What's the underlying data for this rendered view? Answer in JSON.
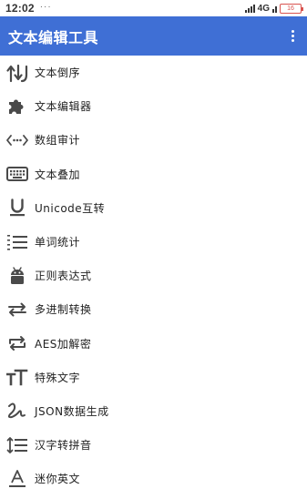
{
  "status_bar": {
    "time": "12:02",
    "dots": "···",
    "network": "4G",
    "battery": "16"
  },
  "app_bar": {
    "title": "文本编辑工具",
    "overflow_icon": "more-vertical-icon"
  },
  "colors": {
    "primary": "#3f6fd5",
    "icon": "#4a4a4a",
    "text": "#222222",
    "battery": "#d9534f"
  },
  "menu": {
    "items": [
      {
        "label": "文本倒序",
        "icon": "swap-vertical-icon"
      },
      {
        "label": "文本编辑器",
        "icon": "puzzle-icon"
      },
      {
        "label": "数组审计",
        "icon": "code-dots-icon"
      },
      {
        "label": "文本叠加",
        "icon": "keyboard-icon"
      },
      {
        "label": "Unicode互转",
        "icon": "underline-icon"
      },
      {
        "label": "单词统计",
        "icon": "list-numbered-icon"
      },
      {
        "label": "正则表达式",
        "icon": "android-icon"
      },
      {
        "label": "多进制转换",
        "icon": "swap-horizontal-icon"
      },
      {
        "label": "AES加解密",
        "icon": "repeat-icon"
      },
      {
        "label": "特殊文字",
        "icon": "format-size-icon"
      },
      {
        "label": "JSON数据生成",
        "icon": "gesture-icon"
      },
      {
        "label": "汉字转拼音",
        "icon": "line-spacing-icon"
      },
      {
        "label": "迷你英文",
        "icon": "text-a-icon"
      }
    ]
  }
}
